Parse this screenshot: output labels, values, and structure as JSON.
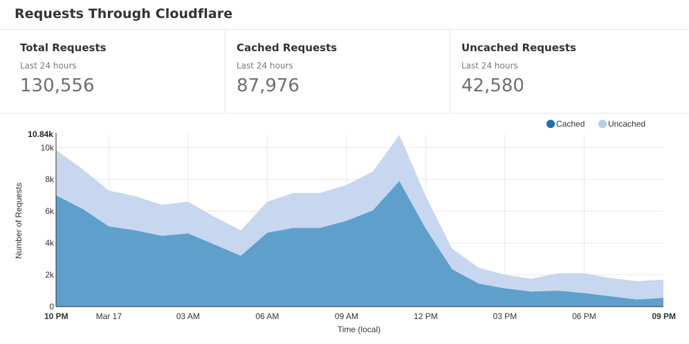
{
  "header": {
    "title": "Requests Through Cloudflare"
  },
  "stats": [
    {
      "title": "Total Requests",
      "subtitle": "Last 24 hours",
      "value": "130,556"
    },
    {
      "title": "Cached Requests",
      "subtitle": "Last 24 hours",
      "value": "87,976"
    },
    {
      "title": "Uncached Requests",
      "subtitle": "Last 24 hours",
      "value": "42,580"
    }
  ],
  "colors": {
    "cached": "#5f9fcb",
    "uncached": "#c7d7f0",
    "cached_legend": "#1f6fae",
    "uncached_legend": "#b5cbec"
  },
  "chart_data": {
    "type": "area",
    "stacked": true,
    "ylabel": "Number of Requests",
    "xlabel": "Time (local)",
    "ymax_label": "10.84k",
    "ylim": [
      0,
      10840
    ],
    "yticks": [
      {
        "value": 0,
        "label": "0"
      },
      {
        "value": 2000,
        "label": "2k"
      },
      {
        "value": 4000,
        "label": "4k"
      },
      {
        "value": 6000,
        "label": "6k"
      },
      {
        "value": 8000,
        "label": "8k"
      },
      {
        "value": 10000,
        "label": "10k"
      }
    ],
    "xticks": [
      {
        "index": 0,
        "label": "10 PM",
        "bold": true,
        "grid": false
      },
      {
        "index": 2,
        "label": "Mar 17",
        "bold": false,
        "grid": true
      },
      {
        "index": 5,
        "label": "03 AM",
        "bold": false,
        "grid": true
      },
      {
        "index": 8,
        "label": "06 AM",
        "bold": false,
        "grid": true
      },
      {
        "index": 11,
        "label": "09 AM",
        "bold": false,
        "grid": true
      },
      {
        "index": 14,
        "label": "12 PM",
        "bold": false,
        "grid": true
      },
      {
        "index": 17,
        "label": "03 PM",
        "bold": false,
        "grid": true
      },
      {
        "index": 20,
        "label": "06 PM",
        "bold": false,
        "grid": true
      },
      {
        "index": 23,
        "label": "09 PM",
        "bold": true,
        "grid": false
      }
    ],
    "legend": {
      "placement": "top-right"
    },
    "series": [
      {
        "name": "Cached",
        "values": [
          7000,
          6150,
          5050,
          4800,
          4450,
          4600,
          3900,
          3200,
          4650,
          4950,
          4950,
          5400,
          6050,
          7900,
          4900,
          2350,
          1450,
          1150,
          950,
          1000,
          850,
          650,
          450,
          550
        ]
      },
      {
        "name": "Uncached",
        "values": [
          2850,
          2500,
          2250,
          2150,
          1950,
          2000,
          1750,
          1600,
          1950,
          2200,
          2200,
          2250,
          2450,
          2900,
          2050,
          1300,
          1000,
          850,
          800,
          1100,
          1250,
          1150,
          1150,
          1150
        ]
      }
    ]
  }
}
